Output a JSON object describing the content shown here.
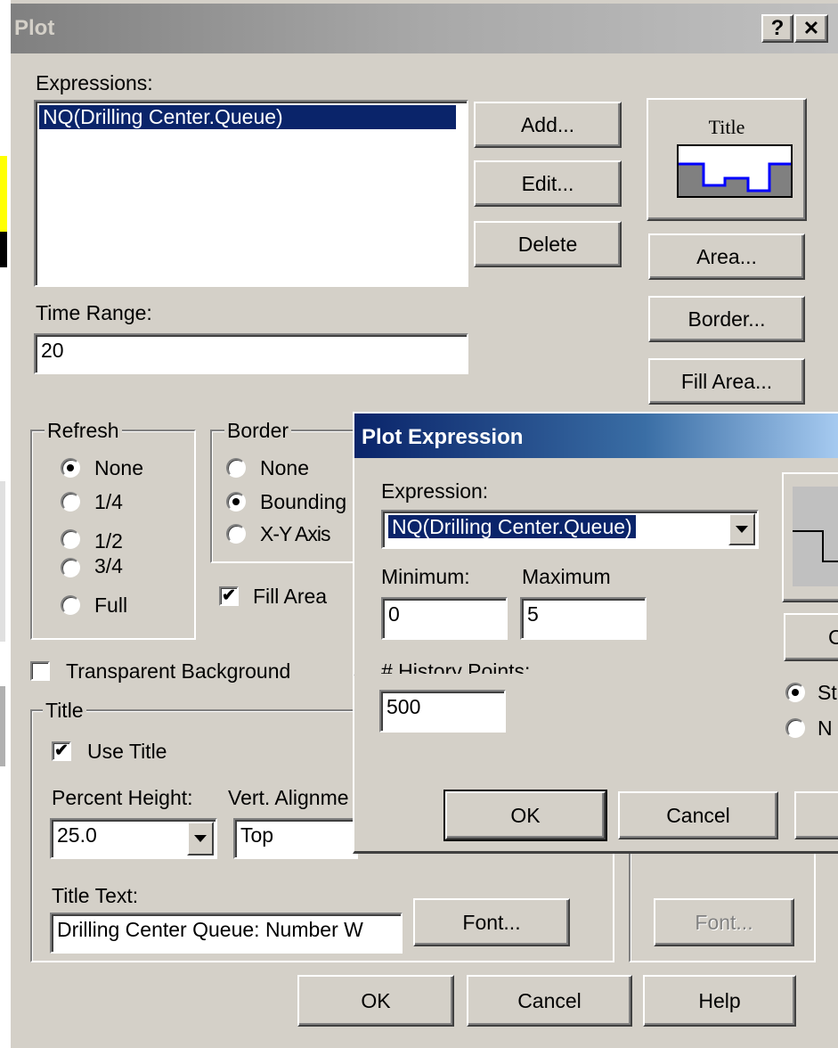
{
  "main_dialog": {
    "title": "Plot",
    "help_glyph": "?",
    "close_glyph": "✕",
    "expressions_label": "Expressions:",
    "expressions": [
      "NQ(Drilling Center.Queue)"
    ],
    "selected_expression_index": 0,
    "add_button": "Add...",
    "edit_button": "Edit...",
    "delete_button": "Delete",
    "preview_title": "Title",
    "area_button": "Area...",
    "border_button": "Border...",
    "fill_area_button": "Fill Area...",
    "time_range_label": "Time Range:",
    "time_range_value": "20",
    "refresh": {
      "label": "Refresh",
      "options": [
        "None",
        "1/4",
        "1/2",
        "3/4",
        "Full"
      ],
      "selected": "None"
    },
    "border": {
      "label": "Border",
      "options": [
        "None",
        "Bounding",
        "X-Y Axis"
      ],
      "selected": "Bounding"
    },
    "fill_area_checkbox": {
      "label": "Fill Area",
      "checked": true
    },
    "transparent_background": {
      "label": "Transparent Background",
      "checked": false
    },
    "title_group": {
      "label": "Title",
      "use_title": {
        "label": "Use Title",
        "checked": true
      },
      "percent_height_label": "Percent Height:",
      "percent_height_value": "25.0",
      "vert_alignment_label": "Vert. Alignme",
      "vert_alignment_value": "Top",
      "title_text_label": "Title Text:",
      "title_text_value": "Drilling Center Queue: Number W",
      "font_button": "Font...",
      "font_button_disabled": "Font..."
    },
    "ok_button": "OK",
    "cancel_button": "Cancel",
    "help_button": "Help"
  },
  "expr_dialog": {
    "title": "Plot Expression",
    "expression_label": "Expression:",
    "expression_value": "NQ(Drilling Center.Queue)",
    "minimum_label": "Minimum:",
    "minimum_value": "0",
    "maximum_label": "Maximum",
    "maximum_value": "5",
    "history_points_label": "# History Points:",
    "history_points_value": "500",
    "side_button_partial": "C",
    "radio_partial_1": "St",
    "radio_partial_2": "N",
    "ok_button": "OK",
    "cancel_button": "Cancel"
  },
  "colors": {
    "dialog_bg": "#d4d0c8",
    "selection": "#0a246a",
    "preview_line": "#0000ff",
    "preview_fill": "#808080"
  }
}
